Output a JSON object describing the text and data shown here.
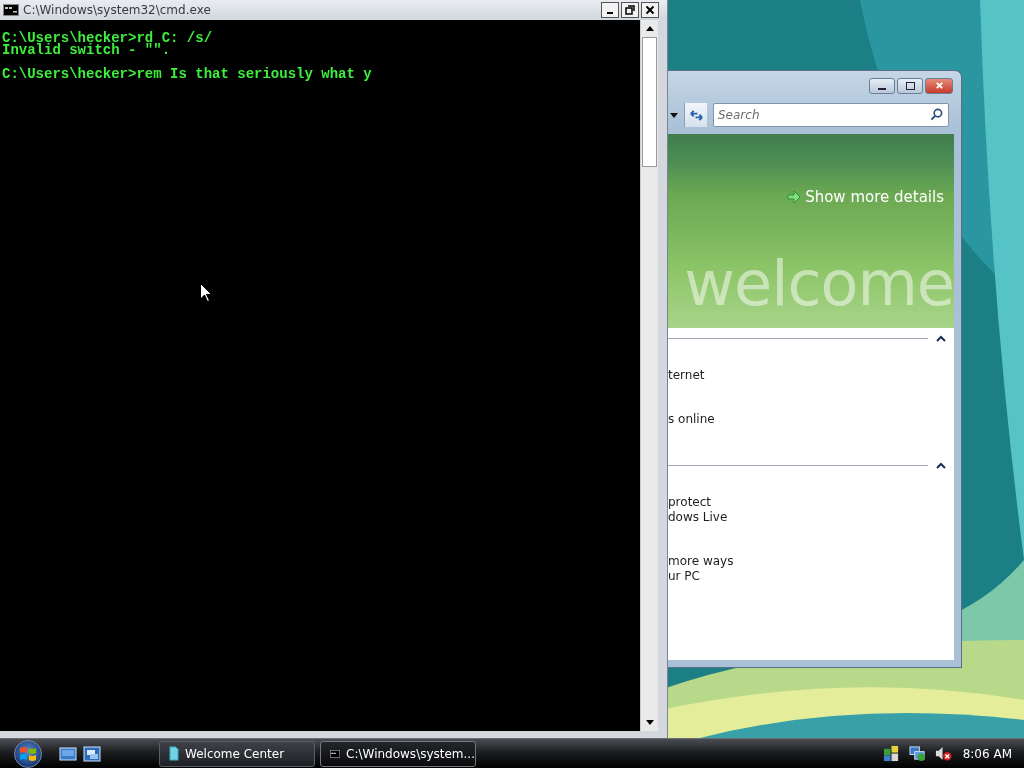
{
  "cmd_window": {
    "title": "C:\\Windows\\system32\\cmd.exe",
    "output_blocks": [
      {
        "lines": [
          "C:\\Users\\hecker>rd C: /s/",
          "Invalid switch - \"\"."
        ]
      },
      {
        "lines": [
          "C:\\Users\\hecker>rem Is that seriously what y"
        ]
      }
    ]
  },
  "welcome_window": {
    "search": {
      "placeholder": "Search"
    },
    "banner_link": "Show more details",
    "banner_word": "welcome",
    "sections": [
      {
        "expanded": true,
        "items": [
          {
            "lines": [
              "ternet"
            ]
          },
          {
            "lines": [
              "s online"
            ]
          }
        ]
      },
      {
        "expanded": true,
        "items": [
          {
            "lines": [
              "protect",
              "dows Live"
            ]
          },
          {
            "lines": [
              "more ways",
              "ur PC"
            ]
          }
        ]
      }
    ]
  },
  "taskbar": {
    "buttons": [
      {
        "label": "Welcome Center",
        "kind": "welcome",
        "selected": false
      },
      {
        "label": "C:\\Windows\\system...",
        "kind": "console",
        "selected": true
      }
    ],
    "clock": "8:06 AM"
  }
}
